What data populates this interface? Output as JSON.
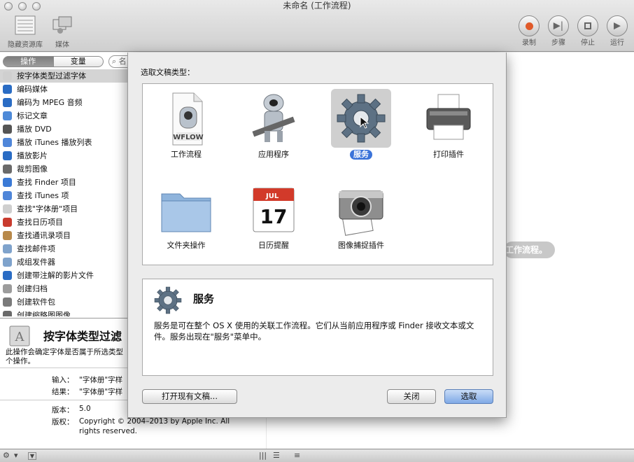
{
  "window": {
    "title": "未命名 (工作流程)"
  },
  "toolbar": {
    "left_items": [
      {
        "label": "隐藏资源库",
        "icon": "sidebar-icon"
      },
      {
        "label": "媒体",
        "icon": "media-icon"
      }
    ],
    "right_items": [
      {
        "label": "录制",
        "icon": "record-icon"
      },
      {
        "label": "步骤",
        "icon": "step-icon"
      },
      {
        "label": "停止",
        "icon": "stop-icon"
      },
      {
        "label": "运行",
        "icon": "run-icon"
      }
    ]
  },
  "library": {
    "tabs": [
      {
        "label": "操作",
        "selected": true
      },
      {
        "label": "变量",
        "selected": false
      }
    ],
    "search_placeholder": "名",
    "actions": [
      {
        "label": "按字体类型过滤字体",
        "icon": "font-book-icon",
        "color": "#cfcfcf",
        "selected": true
      },
      {
        "label": "编码媒体",
        "icon": "quicktime-icon",
        "color": "#2a6cc4"
      },
      {
        "label": "编码为 MPEG 音频",
        "icon": "quicktime-icon",
        "color": "#2a6cc4"
      },
      {
        "label": "标记文章",
        "icon": "rss-icon",
        "color": "#4e8ad8"
      },
      {
        "label": "播放 DVD",
        "icon": "dvd-icon",
        "color": "#555555"
      },
      {
        "label": "播放 iTunes 播放列表",
        "icon": "itunes-icon",
        "color": "#4f86d9"
      },
      {
        "label": "播放影片",
        "icon": "quicktime-icon",
        "color": "#2a6cc4"
      },
      {
        "label": "裁剪图像",
        "icon": "preview-icon",
        "color": "#6a6a6a"
      },
      {
        "label": "查找 Finder 项目",
        "icon": "finder-icon",
        "color": "#3b7ad6"
      },
      {
        "label": "查找 iTunes 项",
        "icon": "itunes-icon",
        "color": "#4f86d9"
      },
      {
        "label": "查找\"字体册\"项目",
        "icon": "font-book-icon",
        "color": "#cfcfcf"
      },
      {
        "label": "查找日历项目",
        "icon": "calendar-icon",
        "color": "#c93b2e"
      },
      {
        "label": "查找通讯录项目",
        "icon": "contacts-icon",
        "color": "#b8894a"
      },
      {
        "label": "查找邮件项",
        "icon": "mail-icon",
        "color": "#7fa3cc"
      },
      {
        "label": "成组发件器",
        "icon": "mail-icon",
        "color": "#7fa3cc"
      },
      {
        "label": "创建带注解的影片文件",
        "icon": "quicktime-icon",
        "color": "#2a6cc4"
      },
      {
        "label": "创建归档",
        "icon": "archive-icon",
        "color": "#9c9c9c"
      },
      {
        "label": "创建软件包",
        "icon": "tools-icon",
        "color": "#7a7a7a"
      },
      {
        "label": "创建缩略图图像",
        "icon": "preview-icon",
        "color": "#6a6a6a"
      }
    ]
  },
  "description": {
    "title": "按字体类型过滤",
    "text": "此操作会确定字体是否属于所选类型个操作。",
    "input_label": "输入：",
    "input_value": "\"字体册\"字样",
    "result_label": "结果：",
    "result_value": "\"字体册\"字样",
    "version_label": "版本：",
    "version_value": "5.0",
    "copyright_label": "版权：",
    "copyright_value": "Copyright © 2004–2013 by Apple Inc. All rights reserved."
  },
  "canvas": {
    "hint": "工作流程。"
  },
  "sheet": {
    "prompt": "选取文稿类型：",
    "types": [
      {
        "label": "工作流程",
        "icon": "workflow-icon",
        "selected": false
      },
      {
        "label": "应用程序",
        "icon": "automator-robot-icon",
        "selected": false
      },
      {
        "label": "服务",
        "icon": "gear-icon",
        "selected": true
      },
      {
        "label": "打印插件",
        "icon": "printer-icon",
        "selected": false
      },
      {
        "label": "文件夹操作",
        "icon": "folder-icon",
        "selected": false
      },
      {
        "label": "日历提醒",
        "icon": "calendar-icon",
        "selected": false
      },
      {
        "label": "图像捕捉插件",
        "icon": "camera-icon",
        "selected": false
      }
    ],
    "workflow_badge": "WFLOW",
    "calendar_month": "JUL",
    "calendar_day": "17",
    "info_title": "服务",
    "info_text": "服务是可在整个 OS X 使用的关联工作流程。它们从当前应用程序或 Finder 接收文本或文件。服务出现在\"服务\"菜单中。",
    "open_existing": "打开现有文稿...",
    "close": "关闭",
    "choose": "选取"
  },
  "bottom": {
    "gear": "⚙",
    "chevron": "▾",
    "log_icon": "☰",
    "list_icon": "≡"
  }
}
